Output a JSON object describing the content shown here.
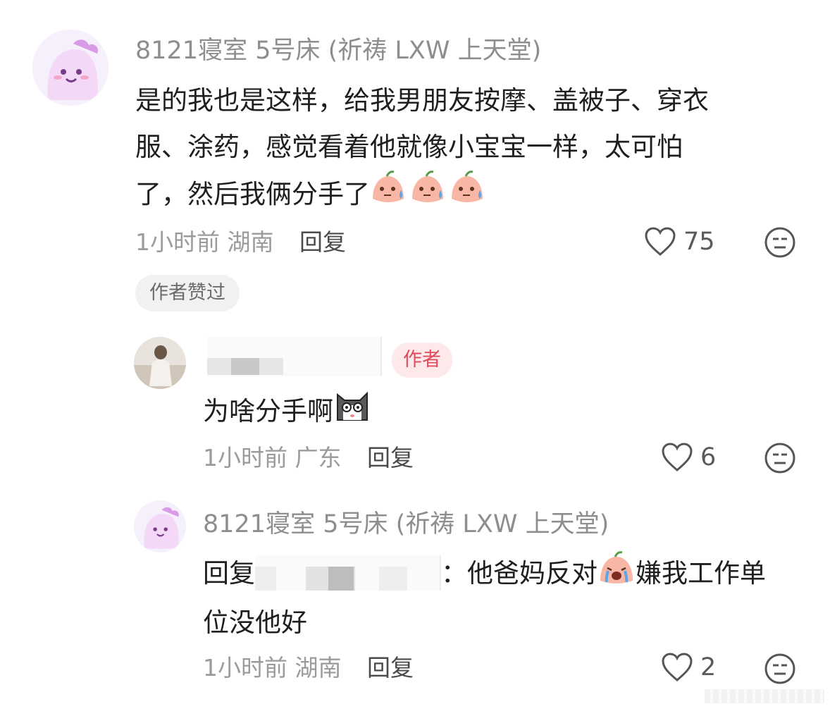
{
  "comment1": {
    "username": "8121寝室 5号床 (祈祷 LXW 上天堂)",
    "text_line1": "是的我也是这样，给我男朋友按摩、盖被子、穿衣",
    "text_line2": "服、涂药，感觉看着他就像小宝宝一样，太可怕",
    "text_line3": "了，然后我俩分手了",
    "time": "1小时前",
    "location": "湖南",
    "reply_label": "回复",
    "likes": "75",
    "badge": "作者赞过"
  },
  "reply1": {
    "author_tag": "作者",
    "text": "为啥分手啊",
    "time": "1小时前",
    "location": "广东",
    "reply_label": "回复",
    "likes": "6"
  },
  "reply2": {
    "username": "8121寝室 5号床 (祈祷 LXW 上天堂)",
    "reply_prefix": "回复",
    "text_part1": "：他爸妈反对",
    "text_part2": "嫌我工作单",
    "text_line2": "位没他好",
    "time": "1小时前",
    "location": "湖南",
    "reply_label": "回复",
    "likes": "2"
  },
  "icons": {
    "like": "heart-outline-icon",
    "dislike": "meh-face-icon",
    "emoji_sweat": "peach-sweat-emoji",
    "emoji_cat": "shocked-cat-emoji",
    "emoji_cry": "peach-cry-emoji"
  }
}
